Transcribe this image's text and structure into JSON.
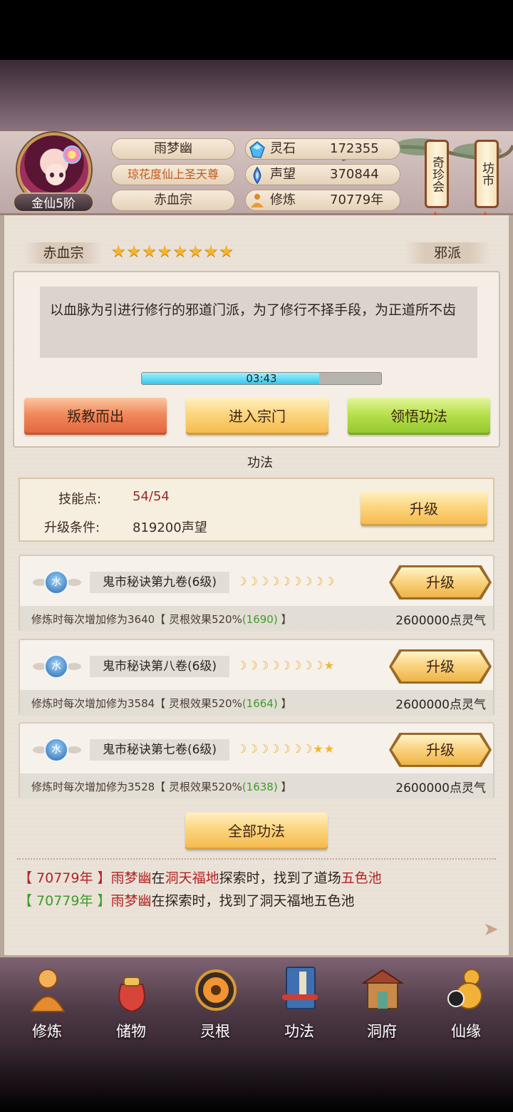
{
  "header": {
    "player_name": "雨梦幽",
    "player_title": "琼花度仙上圣天尊",
    "sect": "赤血宗",
    "rank_badge": "金仙5阶",
    "stats": [
      {
        "icon": "spirit-stone-icon",
        "label": "灵石",
        "value": "172355"
      },
      {
        "icon": "reputation-icon",
        "label": "声望",
        "value": "370844"
      },
      {
        "icon": "cultivation-icon",
        "label": "修炼",
        "value": "70779年"
      }
    ],
    "side_buttons": [
      "奇珍会",
      "坊市"
    ]
  },
  "sect_info": {
    "name": "赤血宗",
    "stars": "★★★★★★★★",
    "star_count": 8,
    "alignment": "邪派",
    "description": "以血脉为引进行修行的邪道门派，为了修行不择手段，为正道所不齿",
    "timer": "03:43",
    "timer_progress": 0.74,
    "actions": [
      "叛教而出",
      "进入宗门",
      "领悟功法"
    ]
  },
  "gongfa": {
    "section_title": "功法",
    "skill_points_label": "技能点:",
    "skill_points_value": "54/54",
    "upgrade_cond_label": "升级条件:",
    "upgrade_cond_value": "819200声望",
    "upgrade_label": "升级",
    "techniques": [
      {
        "element": "水",
        "name": "鬼市秘诀第九卷(6级)",
        "moons": "☽☽☽☽☽☽☽☽☽",
        "stars": "",
        "desc_prefix": "修炼时每次增加修为3640【 灵根效果520%",
        "desc_bonus": "(1690)",
        "desc_suffix": " 】",
        "cost": "2600000点灵气",
        "button": "升级"
      },
      {
        "element": "水",
        "name": "鬼市秘诀第八卷(6级)",
        "moons": "☽☽☽☽☽☽☽☽",
        "stars": "★",
        "desc_prefix": "修炼时每次增加修为3584【 灵根效果520%",
        "desc_bonus": "(1664)",
        "desc_suffix": " 】",
        "cost": "2600000点灵气",
        "button": "升级"
      },
      {
        "element": "水",
        "name": "鬼市秘诀第七卷(6级)",
        "moons": "☽☽☽☽☽☽☽",
        "stars": "★★",
        "desc_prefix": "修炼时每次增加修为3528【 灵根效果520%",
        "desc_bonus": "(1638)",
        "desc_suffix": " 】",
        "cost": "2600000点灵气",
        "button": "升级"
      }
    ],
    "all_button": "全部功法"
  },
  "log": [
    {
      "year": "【 70779年 】",
      "name": "雨梦幽",
      "text1": "在",
      "place": "洞天福地",
      "text2": "探索时，找到了道场",
      "item": "五色池"
    },
    {
      "year": "【 70779年 】",
      "name": "雨梦幽",
      "text1": "在探索时，找到了洞天福地五色池",
      "place": "",
      "text2": "",
      "item": ""
    }
  ],
  "nav": [
    "修炼",
    "储物",
    "灵根",
    "功法",
    "洞府",
    "仙缘"
  ],
  "colors": {
    "red_text": "#b22222",
    "green_text": "#3f9b2a",
    "gold_button": "#f4b84a",
    "timer_fill": "#34c7e8"
  }
}
